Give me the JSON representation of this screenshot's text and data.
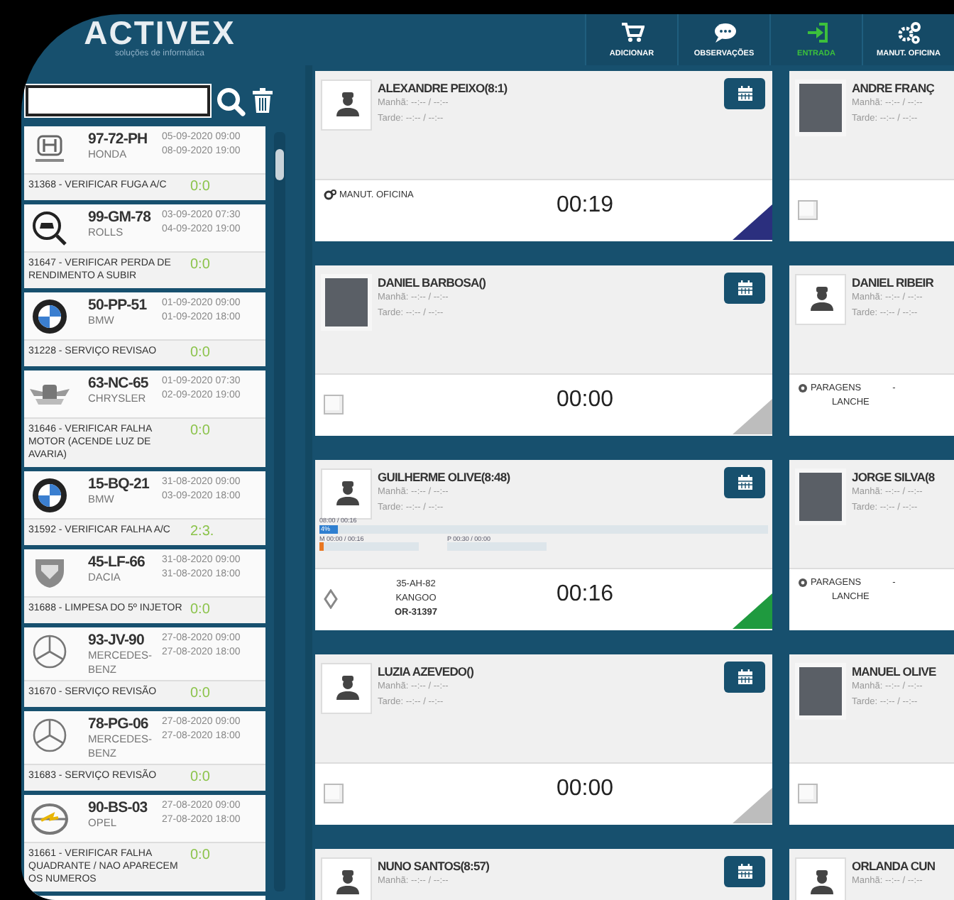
{
  "logo": {
    "name": "ACTIVEX",
    "tagline": "soluções de informática"
  },
  "nav": [
    {
      "label": "ADICIONAR",
      "selected": false
    },
    {
      "label": "OBSERVAÇÕES",
      "selected": false
    },
    {
      "label": "ENTRADA",
      "selected": true
    },
    {
      "label": "MANUT. OFICINA",
      "selected": false
    }
  ],
  "sidebar": {
    "items": [
      {
        "plate": "97-72-PH",
        "brand": "HONDA",
        "start": "05-09-2020 09:00",
        "end": "08-09-2020 19:00",
        "task": "31368 - VERIFICAR FUGA A/C",
        "counter": "0:0"
      },
      {
        "plate": "99-GM-78",
        "brand": "ROLLS",
        "start": "03-09-2020 07:30",
        "end": "04-09-2020 19:00",
        "task": "31647 - VERIFICAR PERDA DE RENDIMENTO A SUBIR",
        "counter": "0:0"
      },
      {
        "plate": "50-PP-51",
        "brand": "BMW",
        "start": "01-09-2020 09:00",
        "end": "01-09-2020 18:00",
        "task": "31228 - SERVIÇO REVISAO",
        "counter": "0:0"
      },
      {
        "plate": "63-NC-65",
        "brand": "CHRYSLER",
        "start": "01-09-2020 07:30",
        "end": "02-09-2020 19:00",
        "task": "31646 - VERIFICAR FALHA MOTOR (ACENDE LUZ DE AVARIA)",
        "counter": "0:0"
      },
      {
        "plate": "15-BQ-21",
        "brand": "BMW",
        "start": "31-08-2020 09:00",
        "end": "03-09-2020 18:00",
        "task": "31592 - VERIFICAR FALHA A/C",
        "counter": "2:3."
      },
      {
        "plate": "45-LF-66",
        "brand": "DACIA",
        "start": "31-08-2020 09:00",
        "end": "31-08-2020 18:00",
        "task": "31688 - LIMPESA DO 5º INJETOR",
        "counter": "0:0"
      },
      {
        "plate": "93-JV-90",
        "brand": "MERCEDES-BENZ",
        "start": "27-08-2020 09:00",
        "end": "27-08-2020 18:00",
        "task": "31670 - SERVIÇO REVISÃO",
        "counter": "0:0"
      },
      {
        "plate": "78-PG-06",
        "brand": "MERCEDES-BENZ",
        "start": "27-08-2020 09:00",
        "end": "27-08-2020 18:00",
        "task": "31683 - SERVIÇO REVISÃO",
        "counter": "0:0"
      },
      {
        "plate": "90-BS-03",
        "brand": "OPEL",
        "start": "27-08-2020 09:00",
        "end": "27-08-2020 18:00",
        "task": "31661 - VERIFICAR FALHA QUADRANTE / NAO APARECEM OS NUMEROS",
        "counter": "0:0"
      }
    ]
  },
  "cards": [
    {
      "name": "ALEXANDRE PEIXO(8:1)",
      "morning": "Manhã: --:-- / --:--",
      "afternoon": "Tarde: --:-- / --:--",
      "footer": {
        "kind": "task",
        "label": "MANUT. OFICINA",
        "timer": "00:19",
        "color": "#2b2f7e"
      }
    },
    {
      "name": "ANDRE FRANÇ",
      "morning": "Manhã: --:-- / --:--",
      "afternoon": "Tarde: --:-- / --:--",
      "footer": {
        "kind": "idle",
        "checked": false
      }
    },
    {
      "name": "DANIEL BARBOSA()",
      "morning": "Manhã: --:-- / --:--",
      "afternoon": "Tarde: --:-- / --:--",
      "footer": {
        "kind": "idle",
        "checked": false,
        "timer": "00:00",
        "color": "#bdbdbd"
      }
    },
    {
      "name": "DANIEL RIBEIR",
      "morning": "Manhã: --:-- / --:--",
      "afternoon": "Tarde: --:-- / --:--",
      "footer": {
        "kind": "stop",
        "label": "PARAGENS",
        "dash": "-",
        "reason": "LANCHE"
      }
    },
    {
      "name": "GUILHERME OLIVE(8:48)",
      "morning": "Manhã: --:-- / --:--",
      "afternoon": "Tarde: --:-- / --:--",
      "progress": {
        "total": "08:00 / 00:16",
        "percent": "4%",
        "level": 0.04,
        "m": "M 00:00 / 00:16",
        "p": "P 00:30 / 00:00"
      },
      "footer": {
        "kind": "job",
        "plate": "35-AH-82",
        "model": "KANGOO",
        "order": "OR-31397",
        "timer": "00:16",
        "color": "#1f9a3f"
      }
    },
    {
      "name": "JORGE SILVA(8",
      "morning": "Manhã: --:-- / --:--",
      "afternoon": "Tarde: --:-- / --:--",
      "footer": {
        "kind": "stop",
        "label": "PARAGENS",
        "dash": "-",
        "reason": "LANCHE"
      }
    },
    {
      "name": "LUZIA AZEVEDO()",
      "morning": "Manhã: --:-- / --:--",
      "afternoon": "Tarde: --:-- / --:--",
      "footer": {
        "kind": "idle",
        "checked": false,
        "timer": "00:00",
        "color": "#bdbdbd"
      }
    },
    {
      "name": "MANUEL OLIVE",
      "morning": "Manhã: --:-- / --:--",
      "afternoon": "Tarde: --:-- / --:--",
      "footer": {
        "kind": "idle",
        "checked": false
      }
    },
    {
      "name": "NUNO SANTOS(8:57)",
      "morning": "Manhã: --:-- / --:--"
    },
    {
      "name": "ORLANDA CUN",
      "morning": "Manhã: --:-- / --:--"
    }
  ]
}
